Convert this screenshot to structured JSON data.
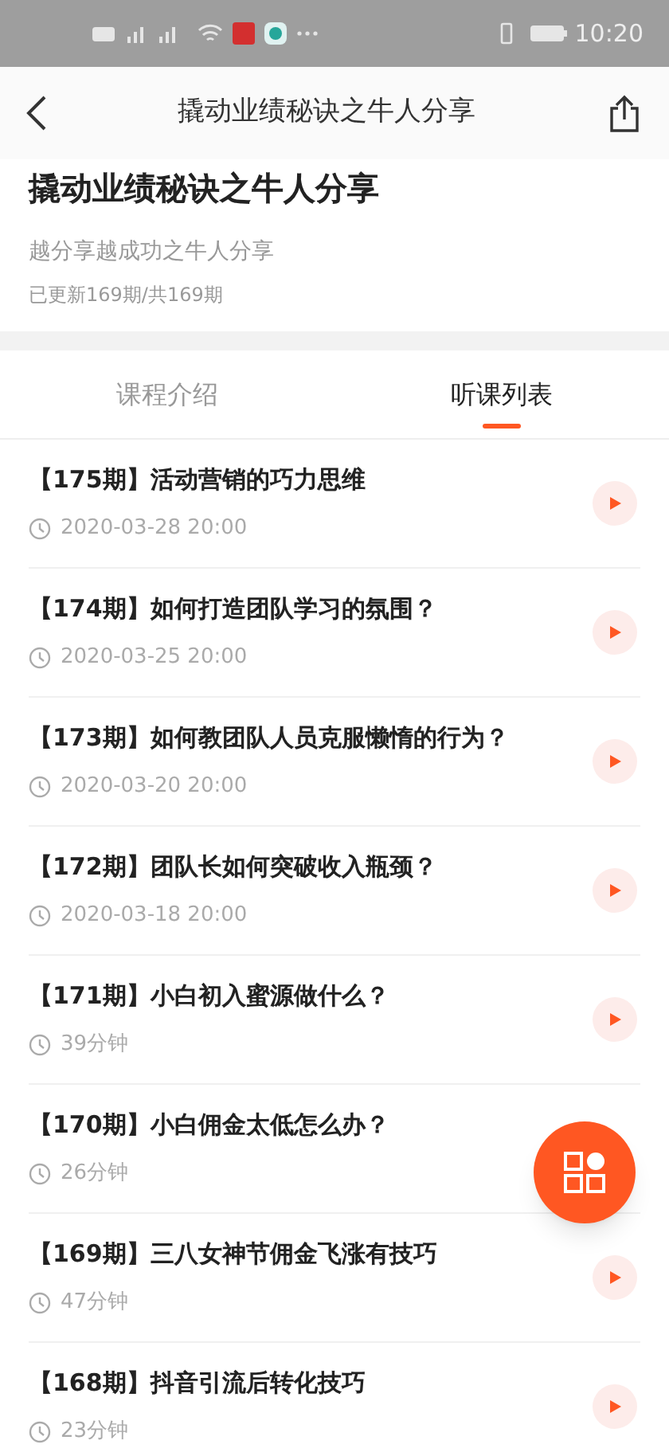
{
  "status_bar": {
    "time": "10:20"
  },
  "header": {
    "title": "撬动业绩秘诀之牛人分享"
  },
  "course": {
    "title": "撬动业绩秘诀之牛人分享",
    "subtitle": "越分享越成功之牛人分享",
    "update_info": "已更新169期/共169期"
  },
  "tabs": [
    {
      "label": "课程介绍",
      "selected": false
    },
    {
      "label": "听课列表",
      "selected": true
    }
  ],
  "lessons": [
    {
      "title": "【175期】活动营销的巧力思维",
      "meta": "2020-03-28 20:00",
      "play_button": true
    },
    {
      "title": "【174期】如何打造团队学习的氛围？",
      "meta": "2020-03-25 20:00",
      "play_button": true
    },
    {
      "title": "【173期】如何教团队人员克服懒惰的行为？",
      "meta": "2020-03-20 20:00",
      "play_button": true
    },
    {
      "title": "【172期】团队长如何突破收入瓶颈？",
      "meta": "2020-03-18 20:00",
      "play_button": true
    },
    {
      "title": "【171期】小白初入蜜源做什么？",
      "meta": "39分钟",
      "play_button": true
    },
    {
      "title": "【170期】小白佣金太低怎么办？",
      "meta": "26分钟",
      "play_button": false
    },
    {
      "title": "【169期】三八女神节佣金飞涨有技巧",
      "meta": "47分钟",
      "play_button": true
    },
    {
      "title": "【168期】抖音引流后转化技巧",
      "meta": "23分钟",
      "play_button": true
    }
  ]
}
